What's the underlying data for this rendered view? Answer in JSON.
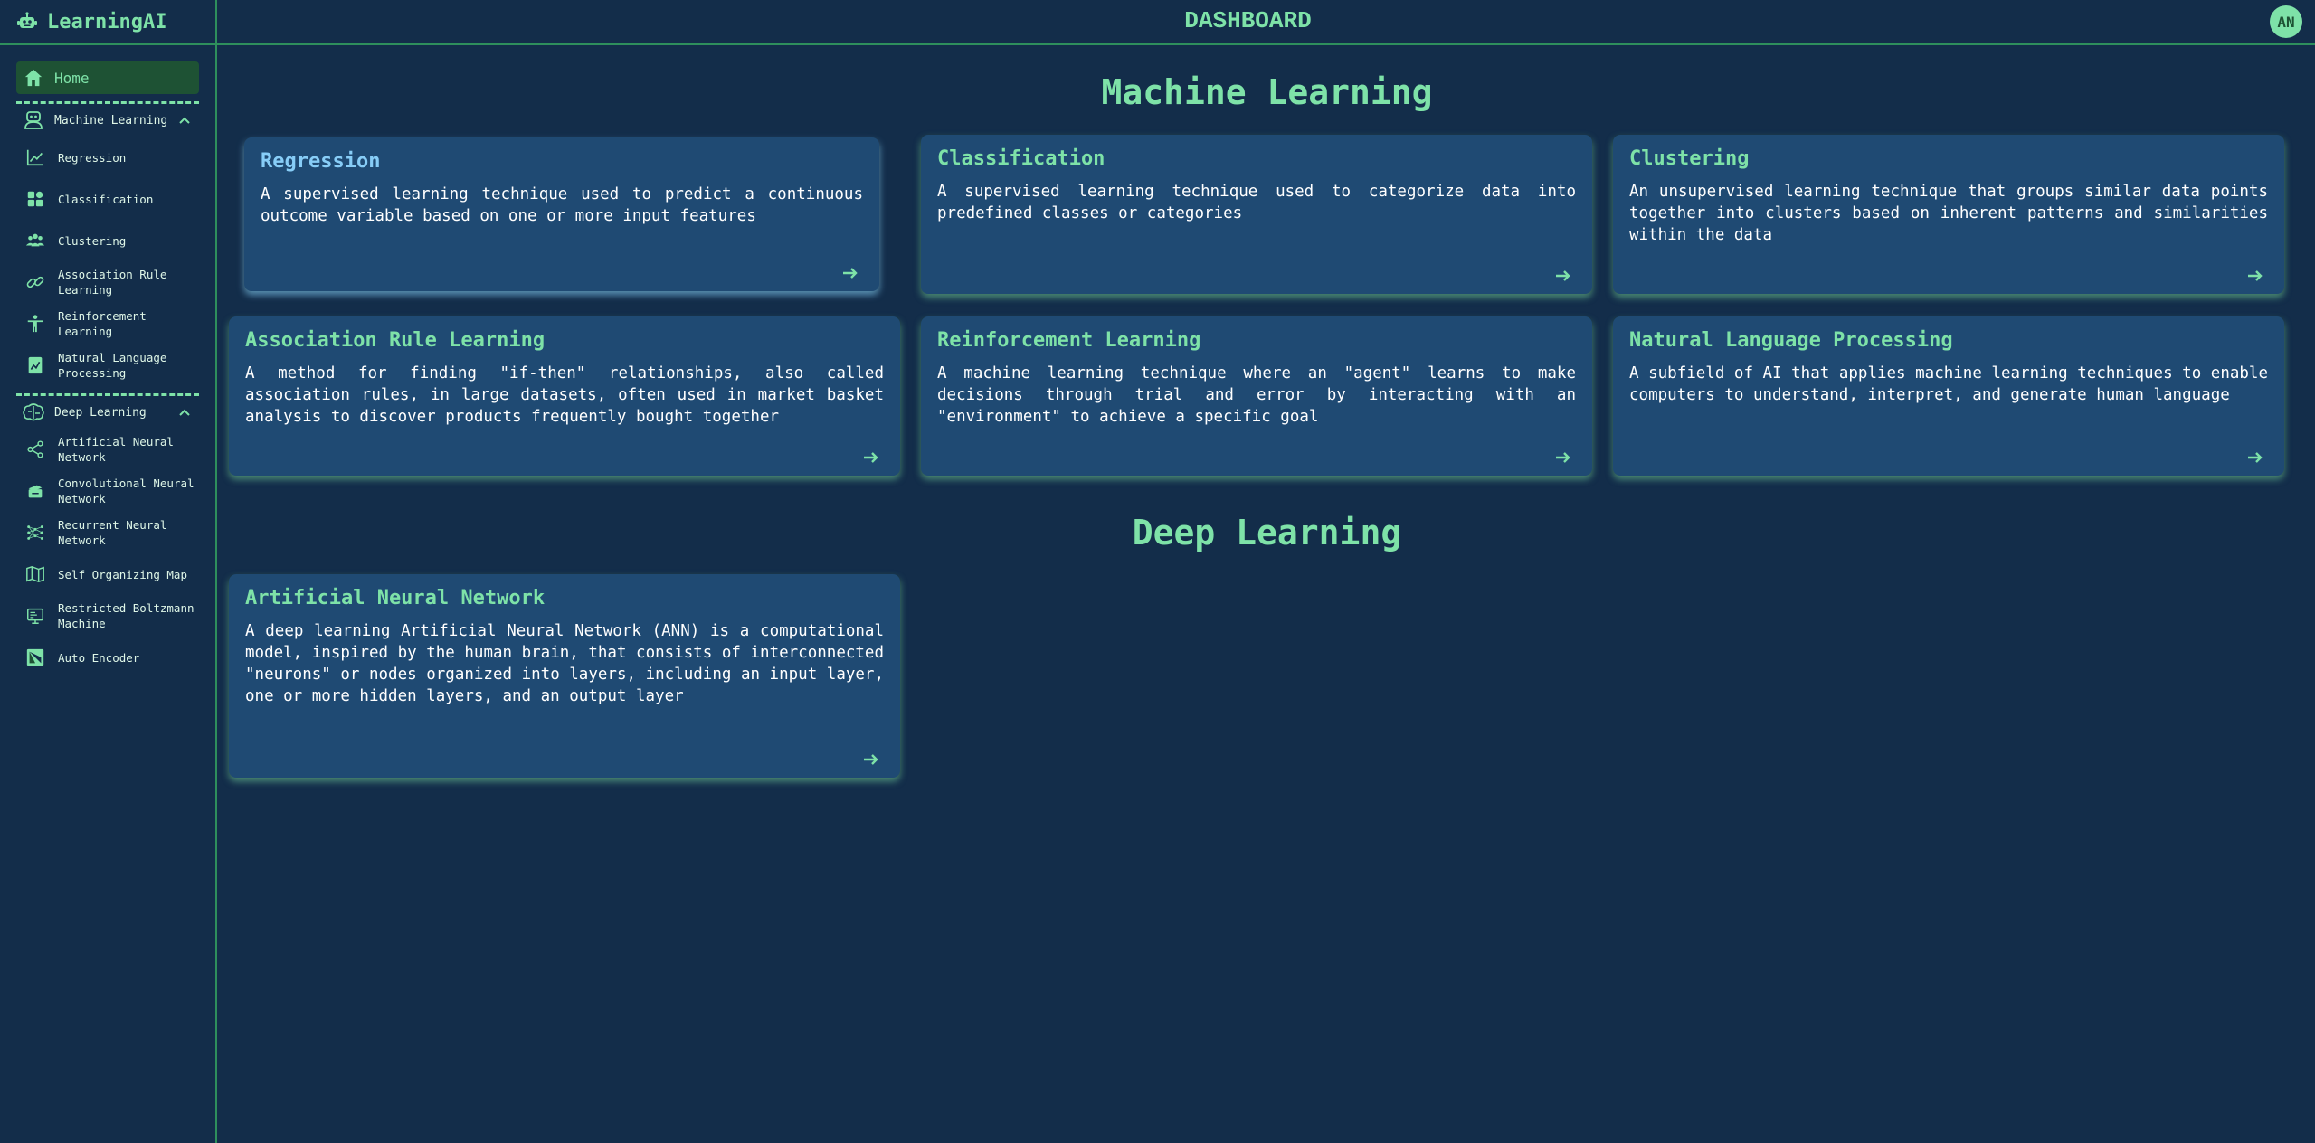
{
  "app": {
    "name": "LearningAI"
  },
  "header": {
    "title": "DASHBOARD",
    "avatar_initials": "AN"
  },
  "sidebar": {
    "home_label": "Home",
    "groups": [
      {
        "label": "Machine Learning",
        "items": [
          {
            "label": "Regression",
            "icon": "line-chart-icon"
          },
          {
            "label": "Classification",
            "icon": "grid-icon"
          },
          {
            "label": "Clustering",
            "icon": "users-icon"
          },
          {
            "label": "Association Rule Learning",
            "icon": "link-icon"
          },
          {
            "label": "Reinforcement Learning",
            "icon": "figure-icon"
          },
          {
            "label": "Natural Language Processing",
            "icon": "document-chart-icon"
          }
        ]
      },
      {
        "label": "Deep Learning",
        "items": [
          {
            "label": "Artificial Neural Network",
            "icon": "share-nodes-icon"
          },
          {
            "label": "Convolutional Neural Network",
            "icon": "layers-icon"
          },
          {
            "label": "Recurrent Neural Network",
            "icon": "network-icon"
          },
          {
            "label": "Self Organizing Map",
            "icon": "map-icon"
          },
          {
            "label": "Restricted Boltzmann Machine",
            "icon": "monitor-icon"
          },
          {
            "label": "Auto Encoder",
            "icon": "image-icon"
          }
        ]
      }
    ]
  },
  "sections": [
    {
      "title": "Machine Learning",
      "cards": [
        {
          "title": "Regression",
          "description": "A supervised learning technique used to predict a continuous outcome variable based on one or more input features"
        },
        {
          "title": "Classification",
          "description": "A supervised learning technique used to categorize data into predefined classes or categories"
        },
        {
          "title": "Clustering",
          "description": "An unsupervised learning technique that groups similar data points together into clusters based on inherent patterns and similarities within the data"
        },
        {
          "title": "Association Rule Learning",
          "description": "A method for finding \"if-then\" relationships, also called association rules, in large datasets, often used in market basket analysis to discover products frequently bought together"
        },
        {
          "title": "Reinforcement Learning",
          "description": "A machine learning technique where an \"agent\" learns to make decisions through trial and error by interacting with an \"environment\" to achieve a specific goal"
        },
        {
          "title": "Natural Language Processing",
          "description": "A subfield of AI that applies machine learning techniques to enable computers to understand, interpret, and generate human language"
        }
      ]
    },
    {
      "title": "Deep Learning",
      "cards": [
        {
          "title": "Artificial Neural Network",
          "description": "A deep learning Artificial Neural Network (ANN) is a computational model, inspired by the human brain, that consists of interconnected \"neurons\" or nodes organized into layers, including an input layer, one or more hidden layers, and an output layer"
        }
      ]
    }
  ],
  "colors": {
    "accent": "#7ee2a8",
    "background": "#132d4a",
    "card": "#1f4a73",
    "active_title": "#87cdf7"
  }
}
